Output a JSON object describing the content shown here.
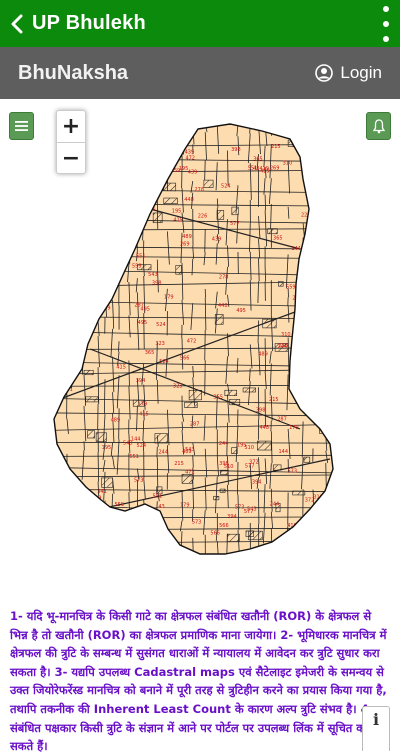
{
  "appbar": {
    "title": "UP Bhulekh",
    "back_icon": "chevron-left-icon",
    "menu_icon": "kebab-menu-icon",
    "bg_color": "#0b8a0b"
  },
  "subbar": {
    "brand": "BhuNaksha",
    "login_label": "Login",
    "login_icon": "user-circle-icon",
    "bg_color": "#5e5e5e"
  },
  "map": {
    "menu_icon": "hamburger-icon",
    "bell_icon": "bell-icon",
    "zoom_in_label": "+",
    "zoom_out_label": "−",
    "parcel_fill": "#fddcb0",
    "parcel_stroke": "#222222",
    "label_color": "#cc1111",
    "plot_numbers": [
      "43",
      "144",
      "179",
      "195",
      "215",
      "226",
      "244",
      "269",
      "278",
      "287",
      "310",
      "323",
      "341",
      "365",
      "372",
      "394",
      "398",
      "415",
      "419",
      "439",
      "448",
      "472",
      "489",
      "495",
      "510",
      "524",
      "543",
      "551",
      "559",
      "566",
      "573",
      "577"
    ]
  },
  "disclaimer": {
    "text": "1- यदि भू-मानचित्र के किसी गाटे का क्षेत्रफल संबंधित खतौनी (ROR) के क्षेत्रफल से भिन्न है तो खतौनी (ROR) का क्षेत्रफल प्रमाणिक माना जायेगा। 2- भूमिधारक मानचित्र में क्षेत्रफल की त्रुटि के सम्बन्ध में सुसंगत धाराओं में न्यायालय में आवेदन कर त्रुटि सुधार करा सकता है। 3- यद्यपि उपलब्ध Cadastral maps एवं सैटेलाइट इमेजरी के समन्वय से उक्त जियोरेफरेंस्ड मानचित्र को बनाने में पूरी तरह से त्रुटिहीन करने का प्रयास किया गया है, तथापि तकनीक की Inherent Least Count के कारण अल्प त्रुटि संभव है। 4- संबंधित पक्षकार किसी त्रुटि के संज्ञान में आने पर पोर्टल पर उपलब्ध लिंक में सूचित कर सकते हैं।",
    "color": "#6a10c8"
  },
  "info_button": {
    "label": "i"
  }
}
